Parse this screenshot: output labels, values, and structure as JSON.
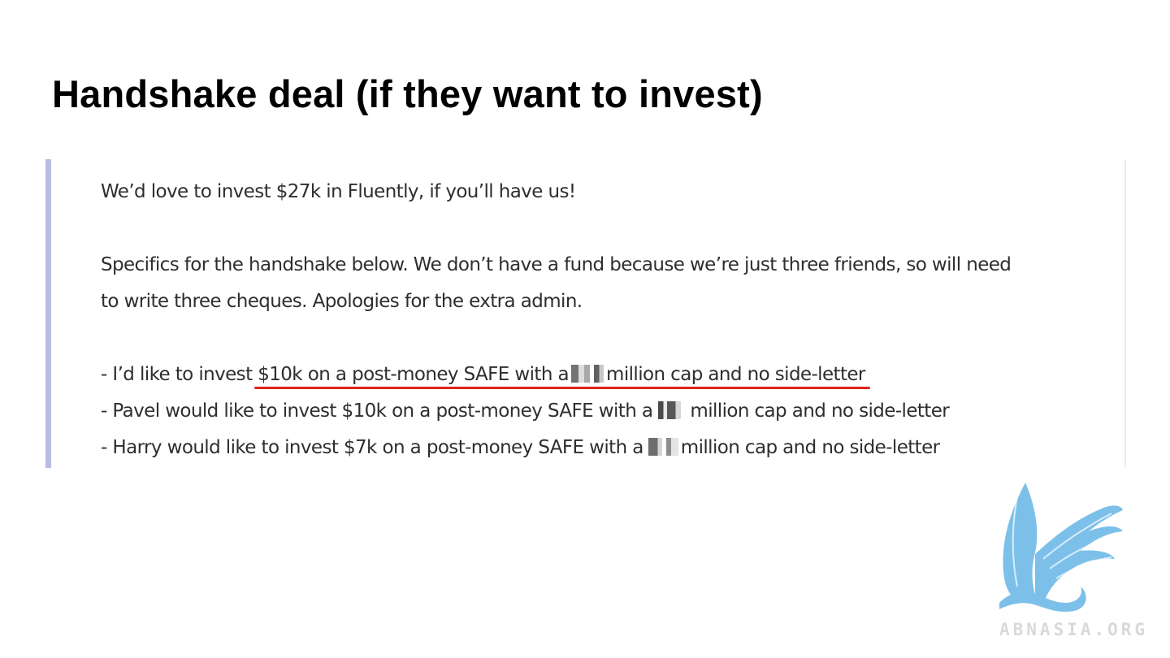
{
  "slide": {
    "title": "Handshake deal (if they want to invest)"
  },
  "message": {
    "intro": "We’d love to invest $27k in Fluently, if you’ll have us!",
    "specifics_line1": "Specifics for the handshake below. We don’t have a fund because we’re just three friends, so will need",
    "specifics_line2": "to write three cheques. Apologies for the extra admin.",
    "items": [
      {
        "prefix": "- I’d like to invest ",
        "highlight_start": "$10k on a post-money SAFE with a",
        "highlight_end": "million cap and no side-letter"
      },
      {
        "prefix": "- Pavel would like to invest $10k on a post-money SAFE with a",
        "suffix": "million cap and no side-letter"
      },
      {
        "prefix": "- Harry would like to invest $7k on a post-money SAFE with a",
        "suffix": "million cap and no side-letter"
      }
    ]
  },
  "branding": {
    "watermark_text": "ABNASIA.ORG",
    "logo_icon": "griffin-logo-icon"
  },
  "colors": {
    "quote_bar": "#b7bde3",
    "underline": "#e0241b",
    "logo": "#7cc0ea"
  }
}
